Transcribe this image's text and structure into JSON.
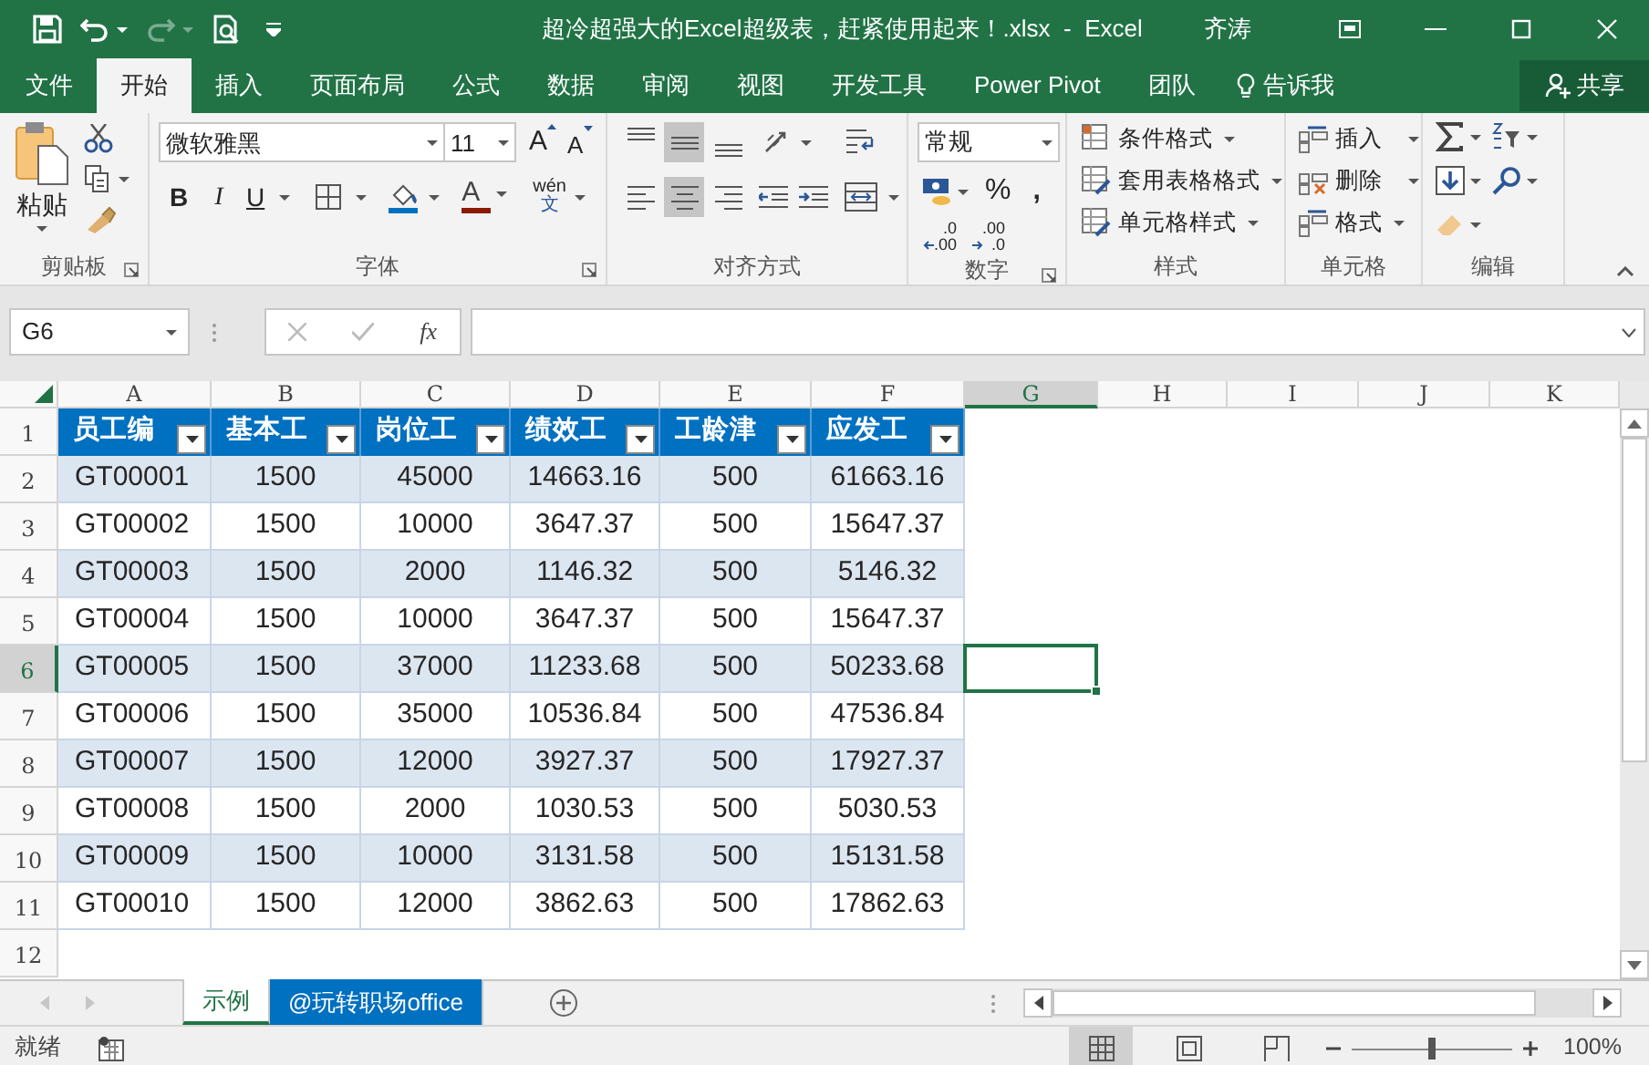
{
  "title_bar": {
    "title": "超冷超强大的Excel超级表，赶紧使用起来！.xlsx  -  Excel",
    "user": "齐涛",
    "redo_disabled": true
  },
  "ribbon_tabs": [
    {
      "label": "文件",
      "selected": false
    },
    {
      "label": "开始",
      "selected": true
    },
    {
      "label": "插入",
      "selected": false
    },
    {
      "label": "页面布局",
      "selected": false
    },
    {
      "label": "公式",
      "selected": false
    },
    {
      "label": "数据",
      "selected": false
    },
    {
      "label": "审阅",
      "selected": false
    },
    {
      "label": "视图",
      "selected": false
    },
    {
      "label": "开发工具",
      "selected": false
    },
    {
      "label": "Power Pivot",
      "selected": false
    },
    {
      "label": "团队",
      "selected": false
    }
  ],
  "tell_me": "告诉我",
  "share": "共享",
  "ribbon": {
    "clipboard": {
      "label": "剪贴板",
      "paste": "粘贴"
    },
    "font": {
      "label": "字体",
      "font_name": "微软雅黑",
      "font_size": "11",
      "grow": "A",
      "shrink": "A",
      "bold": "B",
      "italic": "I",
      "underline": "U",
      "font_color": "A",
      "phonetic_top": "wén",
      "phonetic_bottom": "文"
    },
    "alignment": {
      "label": "对齐方式",
      "vertical": [
        {
          "selected": false
        },
        {
          "selected": true
        },
        {
          "selected": false
        }
      ],
      "horizontal": [
        {
          "selected": false
        },
        {
          "selected": true
        },
        {
          "selected": false
        }
      ]
    },
    "number": {
      "label": "数字",
      "format": "常规",
      "percent": "%",
      "comma": ",",
      "increase_decimal": [
        ".0",
        ".00"
      ],
      "decrease_decimal": [
        ".00",
        ".0"
      ]
    },
    "styles": {
      "label": "样式",
      "commands": [
        "条件格式",
        "套用表格格式",
        "单元格样式"
      ]
    },
    "cells": {
      "label": "单元格",
      "commands": [
        "插入",
        "删除",
        "格式"
      ]
    },
    "editing": {
      "label": "编辑"
    }
  },
  "formula_bar": {
    "name_box": "G6",
    "fx": "fx"
  },
  "columns": [
    {
      "label": "A",
      "selected": false
    },
    {
      "label": "B",
      "selected": false
    },
    {
      "label": "C",
      "selected": false
    },
    {
      "label": "D",
      "selected": false
    },
    {
      "label": "E",
      "selected": false
    },
    {
      "label": "F",
      "selected": false
    },
    {
      "label": "G",
      "selected": true
    },
    {
      "label": "H",
      "selected": false
    },
    {
      "label": "I",
      "selected": false
    },
    {
      "label": "J",
      "selected": false
    },
    {
      "label": "K",
      "selected": false
    }
  ],
  "rows": [
    {
      "label": "1",
      "selected": false
    },
    {
      "label": "2",
      "selected": false
    },
    {
      "label": "3",
      "selected": false
    },
    {
      "label": "4",
      "selected": false
    },
    {
      "label": "5",
      "selected": false
    },
    {
      "label": "6",
      "selected": true
    },
    {
      "label": "7",
      "selected": false
    },
    {
      "label": "8",
      "selected": false
    },
    {
      "label": "9",
      "selected": false
    },
    {
      "label": "10",
      "selected": false
    },
    {
      "label": "11",
      "selected": false
    },
    {
      "label": "12",
      "selected": false
    }
  ],
  "table": {
    "headers": [
      "员工编",
      "基本工",
      "岗位工",
      "绩效工",
      "工龄津",
      "应发工"
    ],
    "rows": [
      [
        "GT00001",
        "1500",
        "45000",
        "14663.16",
        "500",
        "61663.16"
      ],
      [
        "GT00002",
        "1500",
        "10000",
        "3647.37",
        "500",
        "15647.37"
      ],
      [
        "GT00003",
        "1500",
        "2000",
        "1146.32",
        "500",
        "5146.32"
      ],
      [
        "GT00004",
        "1500",
        "10000",
        "3647.37",
        "500",
        "15647.37"
      ],
      [
        "GT00005",
        "1500",
        "37000",
        "11233.68",
        "500",
        "50233.68"
      ],
      [
        "GT00006",
        "1500",
        "35000",
        "10536.84",
        "500",
        "47536.84"
      ],
      [
        "GT00007",
        "1500",
        "12000",
        "3927.37",
        "500",
        "17927.37"
      ],
      [
        "GT00008",
        "1500",
        "2000",
        "1030.53",
        "500",
        "5030.53"
      ],
      [
        "GT00009",
        "1500",
        "10000",
        "3131.58",
        "500",
        "15131.58"
      ],
      [
        "GT00010",
        "1500",
        "12000",
        "3862.63",
        "500",
        "17862.63"
      ]
    ]
  },
  "sheet_tabs": [
    {
      "label": "示例",
      "selected": true
    },
    {
      "label": "@玩转职场office",
      "selected": false,
      "color": "#0070c0"
    }
  ],
  "status_bar": {
    "status": "就绪",
    "views": [
      {
        "selected": true
      },
      {
        "selected": false
      },
      {
        "selected": false
      }
    ],
    "zoom_slider": {
      "level": 0.5
    },
    "zoom": "100%"
  }
}
